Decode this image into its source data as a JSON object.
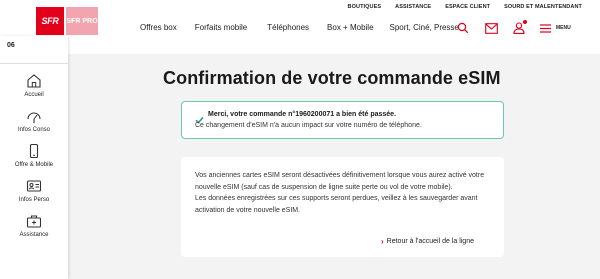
{
  "header": {
    "logo_sfr": "SFR",
    "logo_pro": "SFR PRO",
    "top_links": [
      "BOUTIQUES",
      "ASSISTANCE",
      "ESPACE CLIENT",
      "SOURD ET MALENTENDANT"
    ],
    "nav": [
      "Offres box",
      "Forfaits mobile",
      "Téléphones",
      "Box + Mobile",
      "Sport, Ciné, Presse"
    ],
    "menu_label": "MENU",
    "icons": [
      "search-icon",
      "mail-icon",
      "user-icon",
      "menu-icon"
    ]
  },
  "sidebar": {
    "number": "06",
    "items": [
      {
        "label": "Accueil",
        "icon": "home-icon"
      },
      {
        "label": "Infos Conso",
        "icon": "gauge-icon"
      },
      {
        "label": "Offre & Mobile",
        "icon": "phone-icon"
      },
      {
        "label": "Infos Perso",
        "icon": "id-card-icon"
      },
      {
        "label": "Assistance",
        "icon": "toolbox-icon"
      }
    ]
  },
  "main": {
    "title": "Confirmation de votre commande eSIM",
    "success": {
      "title": "Merci, votre commande n°1960200071 a bien été passée.",
      "subtitle": "Ce changement d'eSIM n'a aucun impact sur votre numéro de téléphone."
    },
    "info": {
      "paragraph1": "Vos anciennes cartes eSIM seront désactivées définitivement lorsque vous aurez activé votre nouvelle eSIM (sauf cas de suspension de ligne suite perte ou vol de votre mobile).",
      "paragraph2": "Les données enregistrées sur ces supports seront perdues, veillez à les sauvegarder avant activation de votre nouvelle eSIM.",
      "back_link": "Retour à l'accueil de la ligne"
    }
  },
  "colors": {
    "brand_red": "#e2001a",
    "success_border": "#6cc7b8",
    "check_green": "#2a9d8f"
  }
}
